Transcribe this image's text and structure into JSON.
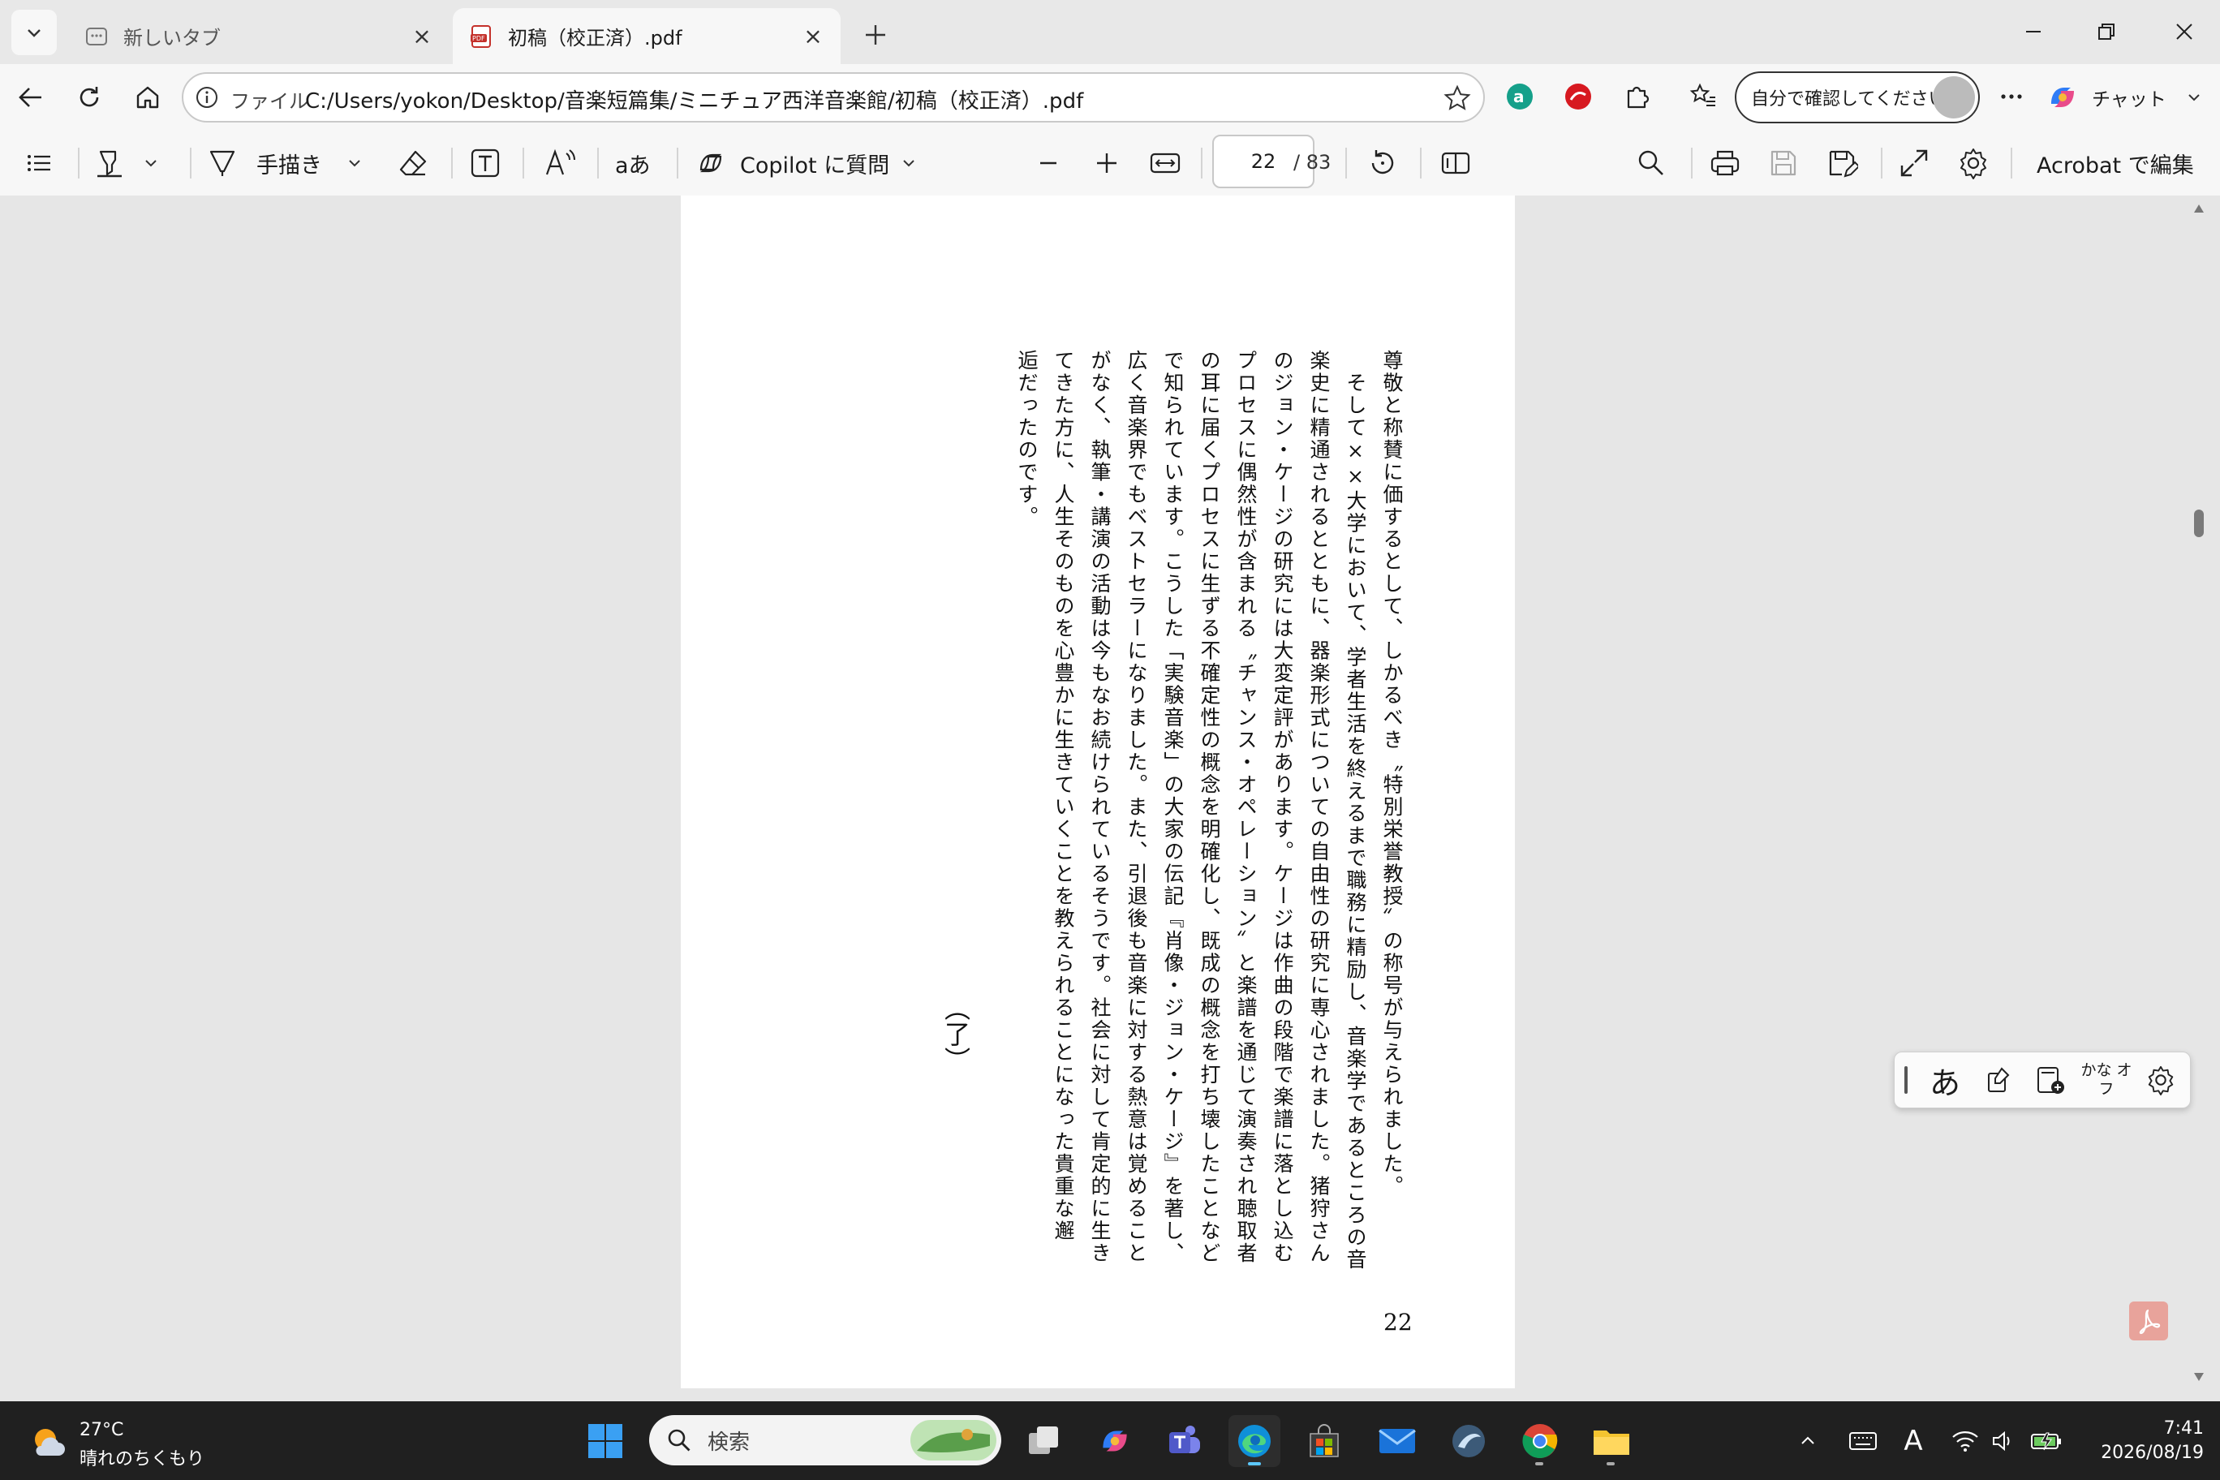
{
  "browser": {
    "tabs": [
      {
        "title": "新しいタブ",
        "active": false
      },
      {
        "title": "初稿（校正済）.pdf",
        "active": true
      }
    ],
    "address": {
      "scheme_label": "ファイル",
      "url": "C:/Users/yokon/Desktop/音楽短篇集/ミニチュア西洋音楽館/初稿（校正済）.pdf"
    },
    "profile_label": "自分で確認してください",
    "copilot_label": "チャット"
  },
  "pdf_toolbar": {
    "draw_label": "手描き",
    "read_aloud_label": "aあ",
    "copilot_label": "Copilot に質問",
    "current_page": "22",
    "total_pages": "/ 83",
    "edit_label": "Acrobat で編集"
  },
  "document": {
    "columns": [
      "尊敬と称賛に価するとして、しかるべき〝特別栄誉教授〟の称号が与えられました。",
      "　そして××大学において、学者生活を終えるまで職務に精励し、音楽学であるところの音",
      "楽史に精通されるとともに、器楽形式についての自由性の研究に専心されました。猪狩さん",
      "のジョン・ケージの研究には大変定評があります。ケージは作曲の段階で楽譜に落とし込む",
      "プロセスに偶然性が含まれる〝チャンス・オペレーション〟と楽譜を通じて演奏され聴取者",
      "の耳に届くプロセスに生ずる不確定性の概念を明確化し、既成の概念を打ち壊したことなど",
      "で知られています。こうした「実験音楽」の大家の伝記『肖像・ジョン・ケージ』を著し、",
      "広く音楽界でもベストセラーになりました。また、引退後も音楽に対する熱意は覚めること",
      "がなく、執筆・講演の活動は今もなお続けられているそうです。社会に対して肯定的に生き",
      "てきた方に、人生そのものを心豊かに生きていくことを教えられることになった貴重な邂",
      "逅だったのです。"
    ],
    "end_mark": "（了）",
    "page_number": "22"
  },
  "ime": {
    "mode": "あ",
    "kana_label": "かな オフ"
  },
  "taskbar": {
    "weather_temp": "27°C",
    "weather_desc": "晴れのちくもり",
    "search_placeholder": "検索",
    "time": "7:41",
    "date": "2026/08/19"
  },
  "colors": {
    "accent": "#0067c0",
    "taskbar_bg": "#202020",
    "viewer_bg": "#e6e6e6"
  }
}
